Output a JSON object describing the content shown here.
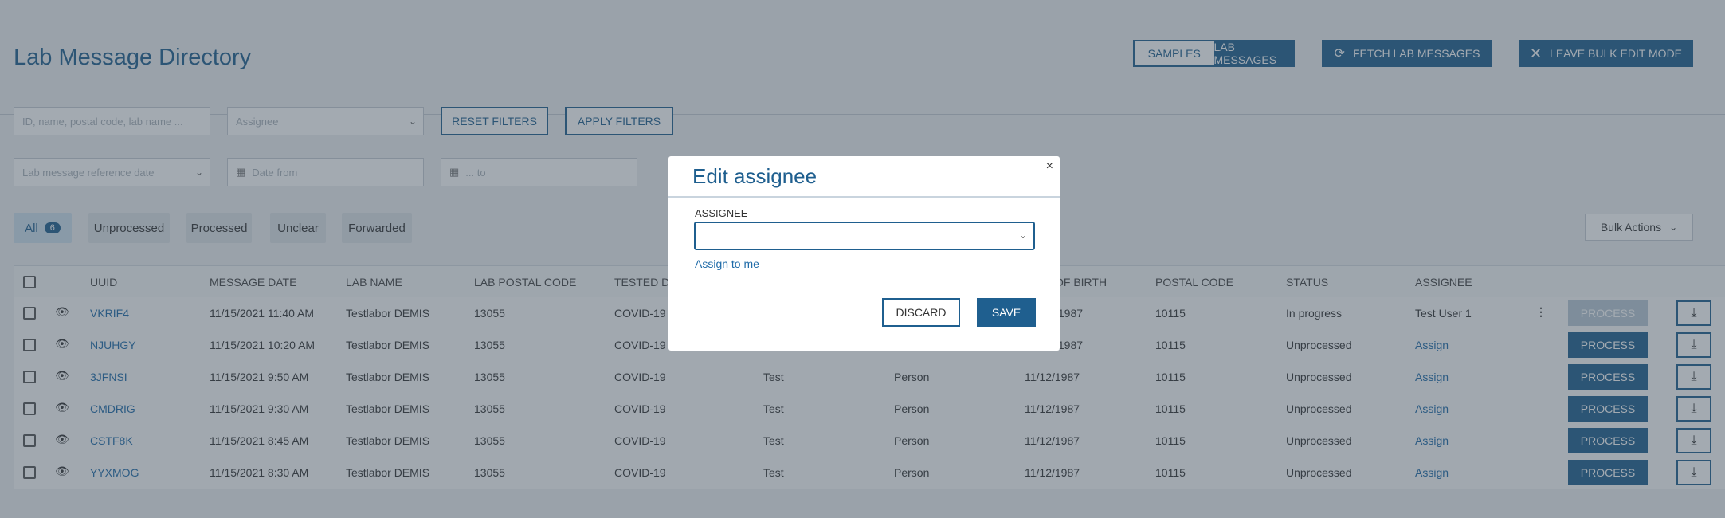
{
  "header": {
    "title": "Lab Message Directory",
    "toggle": {
      "samples": "SAMPLES",
      "lab_messages": "LAB MESSAGES"
    },
    "fetch_label": "FETCH LAB MESSAGES",
    "leave_label": "LEAVE BULK EDIT MODE"
  },
  "filters": {
    "search_placeholder": "ID, name, postal code, lab name ...",
    "assignee_placeholder": "Assignee",
    "reset_label": "RESET FILTERS",
    "apply_label": "APPLY FILTERS",
    "date_type_placeholder": "Lab message reference date",
    "date_from_placeholder": "Date from",
    "date_to_placeholder": "... to"
  },
  "status_chips": {
    "all": "All",
    "all_count": "6",
    "unprocessed": "Unprocessed",
    "processed": "Processed",
    "unclear": "Unclear",
    "forwarded": "Forwarded"
  },
  "bulk_actions_label": "Bulk Actions",
  "table": {
    "headers": {
      "uuid": "UUID",
      "message_date": "MESSAGE DATE",
      "lab_name": "LAB NAME",
      "lab_postal_code": "LAB POSTAL CODE",
      "tested_disease": "TESTED DI",
      "date_of_birth": "OF BIRTH",
      "postal_code": "POSTAL CODE",
      "status": "STATUS",
      "assignee": "ASSIGNEE"
    },
    "process_label": "PROCESS",
    "rows": [
      {
        "uuid": "VKRIF4",
        "date": "11/15/2021 11:40 AM",
        "lab": "Testlabor DEMIS",
        "lab_postal": "13055",
        "disease": "COVID-19",
        "first": "",
        "last": "",
        "dob": "/1987",
        "postal": "10115",
        "status": "In progress",
        "assignee": "Test User 1"
      },
      {
        "uuid": "NJUHGY",
        "date": "11/15/2021 10:20 AM",
        "lab": "Testlabor DEMIS",
        "lab_postal": "13055",
        "disease": "COVID-19",
        "first": "",
        "last": "",
        "dob": "/1987",
        "postal": "10115",
        "status": "Unprocessed",
        "assignee": "Assign"
      },
      {
        "uuid": "3JFNSI",
        "date": "11/15/2021 9:50 AM",
        "lab": "Testlabor DEMIS",
        "lab_postal": "13055",
        "disease": "COVID-19",
        "first": "Test",
        "last": "Person",
        "dob": "11/12/1987",
        "postal": "10115",
        "status": "Unprocessed",
        "assignee": "Assign"
      },
      {
        "uuid": "CMDRIG",
        "date": "11/15/2021 9:30 AM",
        "lab": "Testlabor DEMIS",
        "lab_postal": "13055",
        "disease": "COVID-19",
        "first": "Test",
        "last": "Person",
        "dob": "11/12/1987",
        "postal": "10115",
        "status": "Unprocessed",
        "assignee": "Assign"
      },
      {
        "uuid": "CSTF8K",
        "date": "11/15/2021 8:45 AM",
        "lab": "Testlabor DEMIS",
        "lab_postal": "13055",
        "disease": "COVID-19",
        "first": "Test",
        "last": "Person",
        "dob": "11/12/1987",
        "postal": "10115",
        "status": "Unprocessed",
        "assignee": "Assign"
      },
      {
        "uuid": "YYXMOG",
        "date": "11/15/2021 8:30 AM",
        "lab": "Testlabor DEMIS",
        "lab_postal": "13055",
        "disease": "COVID-19",
        "first": "Test",
        "last": "Person",
        "dob": "11/12/1987",
        "postal": "10115",
        "status": "Unprocessed",
        "assignee": "Assign"
      }
    ]
  },
  "modal": {
    "title": "Edit assignee",
    "close": "×",
    "field_label": "ASSIGNEE",
    "assign_me": "Assign to me",
    "discard": "DISCARD",
    "save": "SAVE"
  },
  "colors": {
    "primary": "#1f5f8f",
    "overlay": "rgba(60,75,90,0.47)"
  }
}
